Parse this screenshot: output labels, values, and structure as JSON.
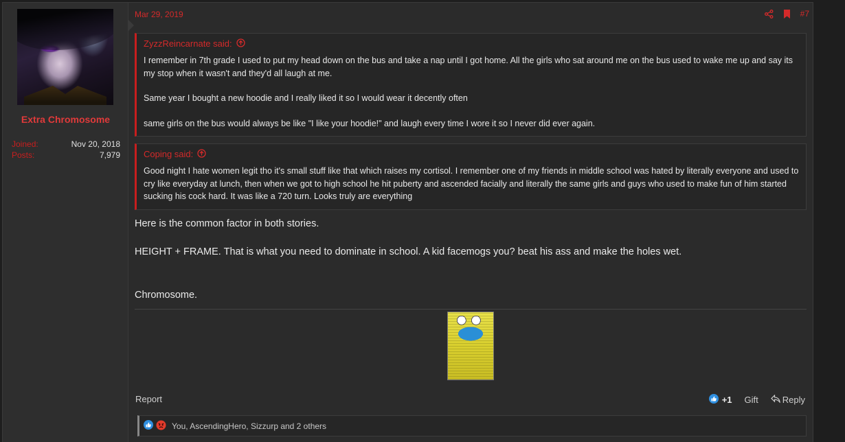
{
  "user": {
    "name": "Extra Chromosome",
    "joined_label": "Joined:",
    "joined_value": "Nov 20, 2018",
    "posts_label": "Posts:",
    "posts_value": "7,979"
  },
  "post": {
    "date": "Mar 29, 2019",
    "number": "#7",
    "quotes": [
      {
        "author": "ZyzzReincarnate said:",
        "paragraphs": [
          "I remember in 7th grade I used to put my head down on the bus and take a nap until I got home. All the girls who sat around me on the bus used to wake me up and say its my stop when it wasn't and they'd all laugh at me.",
          "Same year I bought a new hoodie and I really liked it so I would wear it decently often",
          "same girls on the bus would always be like \"I like your hoodie!\" and laugh every time I wore it so I never did ever again."
        ]
      },
      {
        "author": "Coping said:",
        "paragraphs": [
          "Good night I hate women legit tho it's small stuff like that which raises my cortisol. I remember one of my friends in middle school was hated by literally everyone and used to cry like everyday at lunch, then when we got to high school he hit puberty and ascended facially and literally the same girls and guys who used to make fun of him started sucking his cock hard. It was like a 720 turn. Looks truly are everything"
        ]
      }
    ],
    "message": [
      "Here is the common factor in both stories.",
      "HEIGHT + FRAME. That is what you need to dominate in school. A kid facemogs you? beat his ass and make the holes wet.",
      "Chromosome."
    ]
  },
  "footer": {
    "report": "Report",
    "like_count": "+1",
    "gift": "Gift",
    "reply": "Reply"
  },
  "reactions": {
    "text": "You, AscendingHero, Sizzurp and 2 others"
  },
  "colors": {
    "accent": "#d42a2a",
    "like_blue": "#2f8fe0",
    "angry_red": "#e23b2b"
  },
  "icons": [
    "share-icon",
    "bookmark-icon",
    "upload-arrow-icon",
    "like-icon",
    "angry-icon",
    "reply-arrow-icon"
  ]
}
